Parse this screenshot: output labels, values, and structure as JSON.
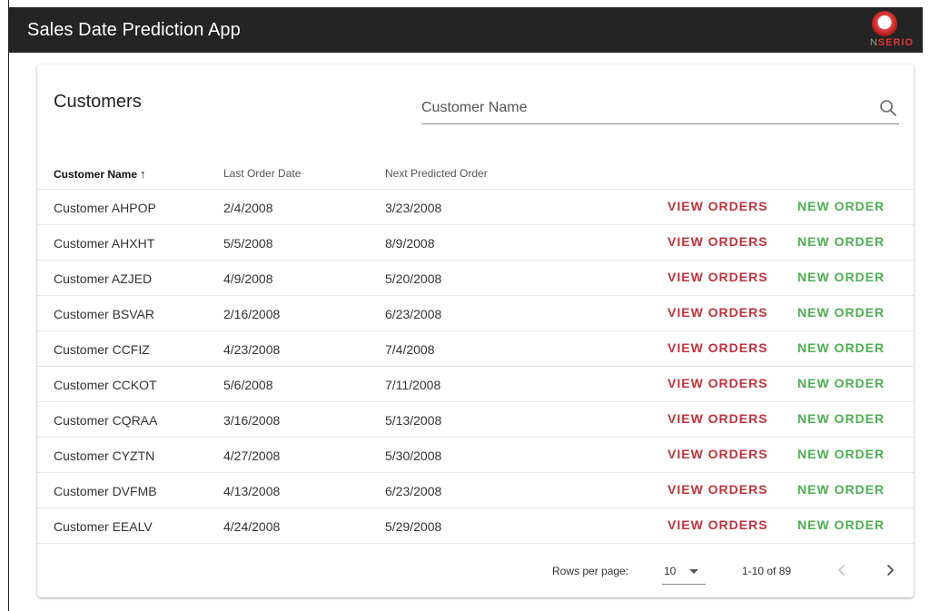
{
  "app": {
    "title": "Sales Date Prediction App",
    "logo_n": "N",
    "logo_serio": "SERIO"
  },
  "card": {
    "title": "Customers",
    "search": {
      "placeholder": "Customer Name",
      "value": ""
    }
  },
  "table": {
    "columns": [
      "Customer Name",
      "Last Order Date",
      "Next Predicted Order"
    ],
    "sort_arrow": "↑",
    "view_label": "VIEW ORDERS",
    "new_label": "NEW ORDER",
    "rows": [
      {
        "name": "Customer AHPOP",
        "last": "2/4/2008",
        "next": "3/23/2008"
      },
      {
        "name": "Customer AHXHT",
        "last": "5/5/2008",
        "next": "8/9/2008"
      },
      {
        "name": "Customer AZJED",
        "last": "4/9/2008",
        "next": "5/20/2008"
      },
      {
        "name": "Customer BSVAR",
        "last": "2/16/2008",
        "next": "6/23/2008"
      },
      {
        "name": "Customer CCFIZ",
        "last": "4/23/2008",
        "next": "7/4/2008"
      },
      {
        "name": "Customer CCKOT",
        "last": "5/6/2008",
        "next": "7/11/2008"
      },
      {
        "name": "Customer CQRAA",
        "last": "3/16/2008",
        "next": "5/13/2008"
      },
      {
        "name": "Customer CYZTN",
        "last": "4/27/2008",
        "next": "5/30/2008"
      },
      {
        "name": "Customer DVFMB",
        "last": "4/13/2008",
        "next": "6/23/2008"
      },
      {
        "name": "Customer EEALV",
        "last": "4/24/2008",
        "next": "5/29/2008"
      }
    ]
  },
  "pagination": {
    "rows_per_page_label": "Rows per page:",
    "rows_per_page": "10",
    "range": "1-10 of 89"
  },
  "colors": {
    "topbar": "#242424",
    "view_orders": "#c0333b",
    "new_order": "#4caf50",
    "logo_red": "#e03535"
  },
  "icons": {
    "search": "search-icon",
    "prev": "chevron-left-icon",
    "next": "chevron-right-icon",
    "sort": "arrow-up-icon",
    "dropdown": "caret-down-icon"
  }
}
